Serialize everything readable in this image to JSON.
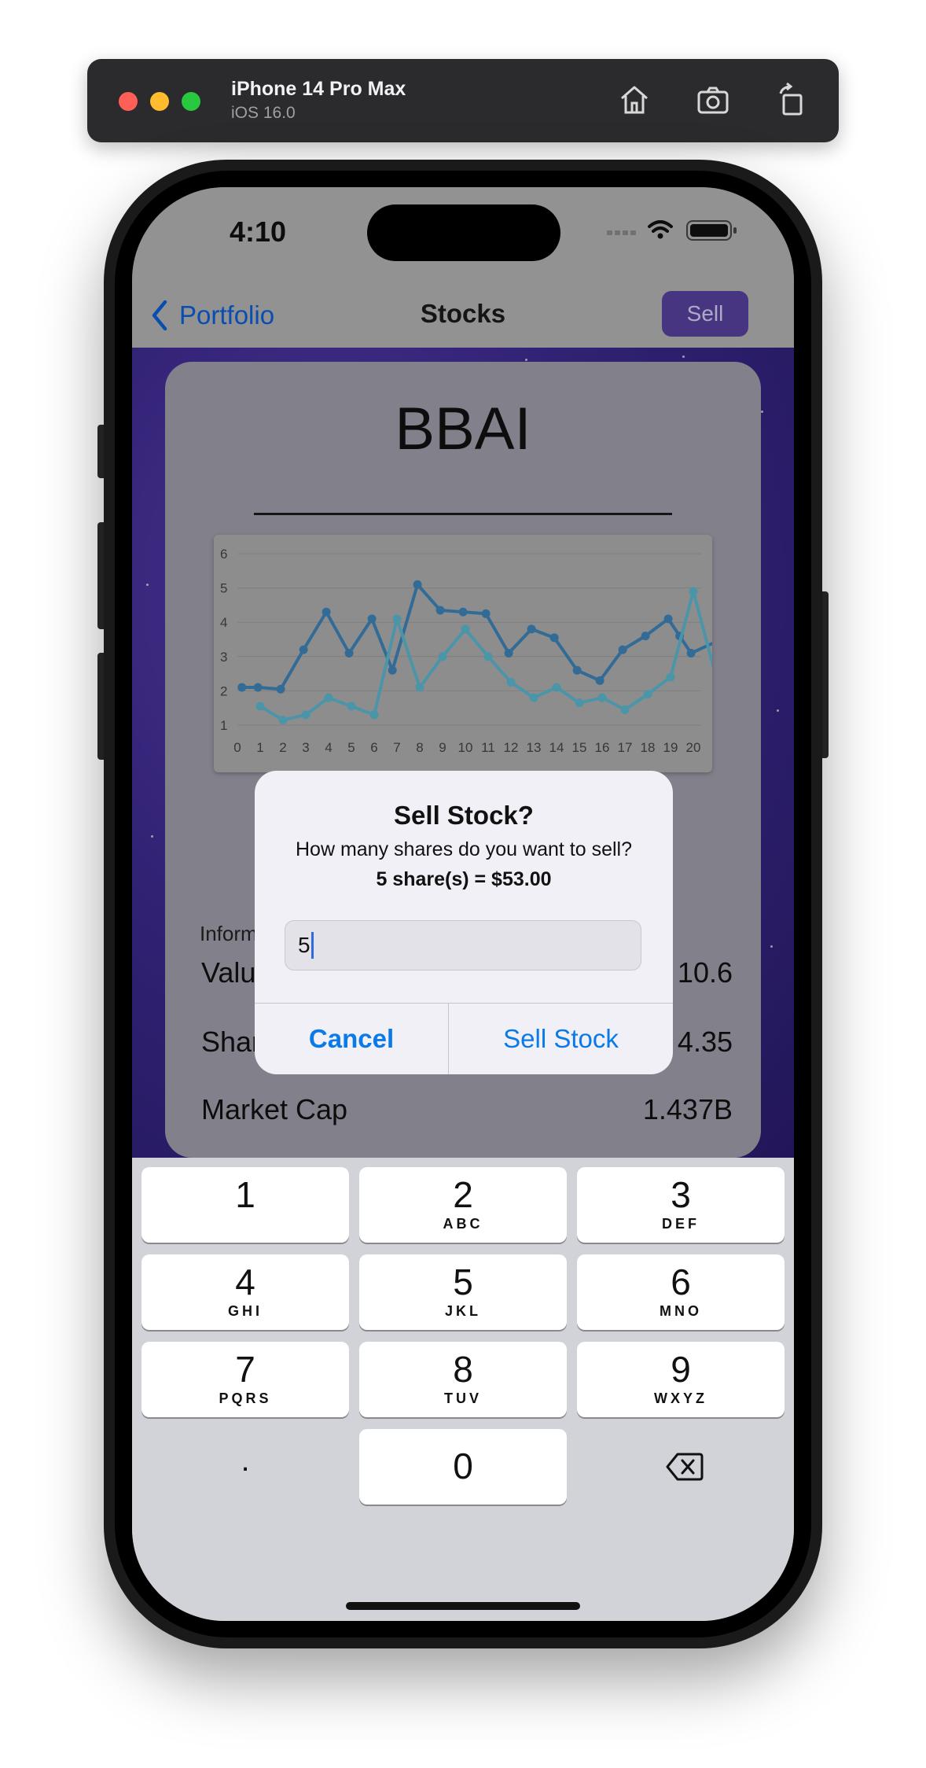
{
  "simulator": {
    "device_name": "iPhone 14 Pro Max",
    "os_version": "iOS 16.0",
    "tools": [
      "home-icon",
      "screenshot-icon",
      "rotate-icon"
    ]
  },
  "status_bar": {
    "time": "4:10"
  },
  "nav": {
    "back_label": "Portfolio",
    "title": "Stocks",
    "action_label": "Sell"
  },
  "stock": {
    "symbol": "BBAI",
    "info_label": "Information",
    "rows": [
      {
        "label": "Value",
        "value": "10.6"
      },
      {
        "label": "Shares",
        "value": "4.35"
      },
      {
        "label": "Market Cap",
        "value": "1.437B"
      }
    ]
  },
  "chart_data": {
    "type": "line",
    "x": [
      0,
      1,
      2,
      3,
      4,
      5,
      6,
      7,
      8,
      9,
      10,
      11,
      12,
      13,
      14,
      15,
      16,
      17,
      18,
      19,
      20
    ],
    "x_ticks": [
      "0",
      "1",
      "2",
      "3",
      "4",
      "5",
      "6",
      "7",
      "8",
      "9",
      "10",
      "11",
      "12",
      "13",
      "14",
      "15",
      "16",
      "17",
      "18",
      "19",
      "20"
    ],
    "y_ticks": [
      "1",
      "2",
      "3",
      "4",
      "5",
      "6"
    ],
    "ylim": [
      1,
      6
    ],
    "grid": true,
    "series": [
      {
        "values": [
          2.1,
          2.1,
          2.05,
          3.2,
          4.3,
          3.1,
          4.1,
          2.6,
          5.1,
          4.35,
          4.3,
          4.25,
          3.1,
          3.8,
          3.55,
          2.6,
          2.3,
          3.2,
          3.6,
          4.1,
          3.6,
          3.1,
          3.4,
          3.0
        ],
        "x_override": [
          0.2,
          0.9,
          1.9,
          2.9,
          3.9,
          4.9,
          5.9,
          6.8,
          7.9,
          8.9,
          9.9,
          10.9,
          11.9,
          12.9,
          13.9,
          14.9,
          15.9,
          16.9,
          17.9,
          18.9,
          19.4,
          19.9,
          20.9,
          21.5
        ],
        "color": "#3d84b8"
      },
      {
        "values": [
          1.55,
          1.15,
          1.3,
          1.8,
          1.55,
          1.3,
          4.1,
          2.1,
          3.0,
          3.8,
          3.0,
          2.25,
          1.8,
          2.1,
          1.65,
          1.8,
          1.45,
          1.9,
          2.4,
          4.9,
          2.4,
          2.4,
          2.4
        ],
        "color": "#5cb6cf"
      }
    ]
  },
  "alert": {
    "title": "Sell Stock?",
    "message": "How many shares do you want to sell?",
    "detail": "5 share(s) = $53.00",
    "input_value": "5",
    "cancel_label": "Cancel",
    "confirm_label": "Sell Stock"
  },
  "keyboard": {
    "keys": [
      {
        "digit": "1",
        "letters": ""
      },
      {
        "digit": "2",
        "letters": "ABC"
      },
      {
        "digit": "3",
        "letters": "DEF"
      },
      {
        "digit": "4",
        "letters": "GHI"
      },
      {
        "digit": "5",
        "letters": "JKL"
      },
      {
        "digit": "6",
        "letters": "MNO"
      },
      {
        "digit": "7",
        "letters": "PQRS"
      },
      {
        "digit": "8",
        "letters": "TUV"
      },
      {
        "digit": "9",
        "letters": "WXYZ"
      },
      {
        "digit": "0",
        "letters": ""
      }
    ],
    "decimal": ".",
    "delete_icon": "backspace-icon"
  },
  "colors": {
    "accent": "#0a7ae8",
    "sell_button": "#57419f",
    "card": "#9f9daa"
  }
}
